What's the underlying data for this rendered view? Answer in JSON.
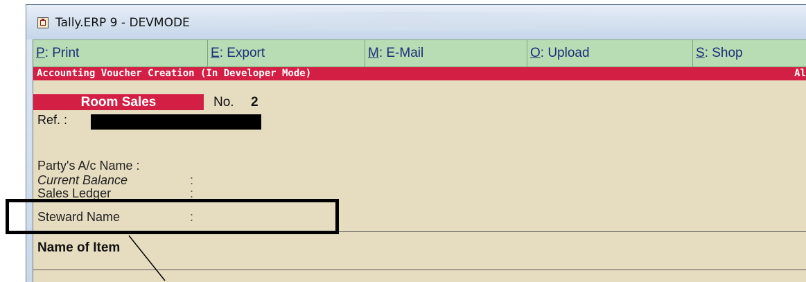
{
  "window": {
    "title": "Tally.ERP 9 - DEVMODE"
  },
  "buttonbar": {
    "buttons": [
      {
        "key": "P",
        "rest": ": Print"
      },
      {
        "key": "E",
        "rest": ": Export"
      },
      {
        "key": "M",
        "rest": ": E-Mail"
      },
      {
        "key": "O",
        "rest": ": Upload"
      },
      {
        "key": "S",
        "rest": ": Shop"
      }
    ]
  },
  "header": {
    "mode_title": "Accounting Voucher Creation (In Developer Mode)",
    "right_cut": "Al"
  },
  "voucher": {
    "type": "Room Sales",
    "number_label": "No.",
    "number": "2",
    "ref_label": "Ref. :"
  },
  "fields": {
    "party_label": "Party's A/c Name :",
    "balance_label": "Current Balance",
    "balance_colon": ":",
    "sales_ledger_label": "Sales Ledger",
    "sales_ledger_colon": ":",
    "steward_label": "Steward Name",
    "steward_colon": ":"
  },
  "table": {
    "col_name": "Name of Item"
  },
  "colors": {
    "header_red": "#d41f45",
    "button_bar_green": "#b8dcb4",
    "background": "#e6dcbf"
  },
  "icons": {
    "app_icon": "tally-app-icon"
  }
}
